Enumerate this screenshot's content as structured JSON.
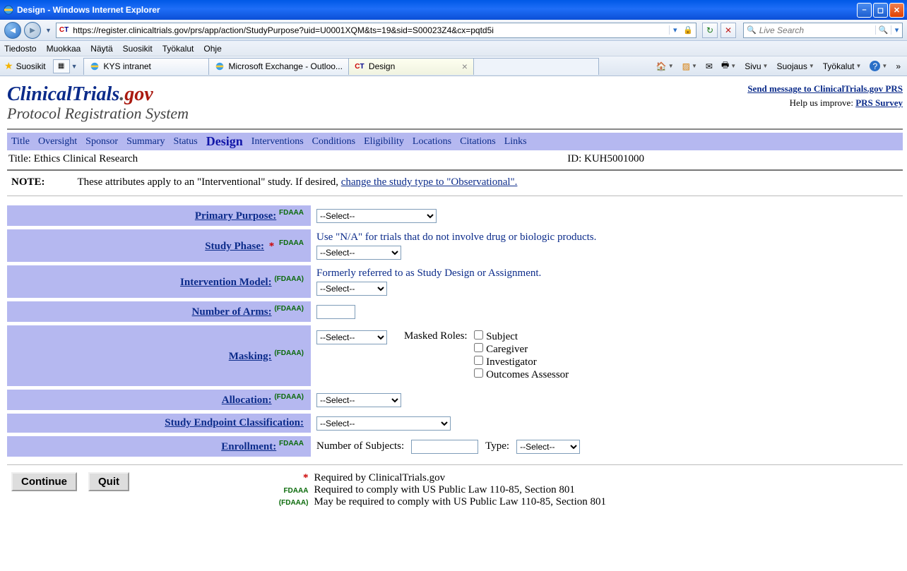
{
  "window": {
    "title": "Design - Windows Internet Explorer"
  },
  "address": {
    "url": "https://register.clinicaltrials.gov/prs/app/action/StudyPurpose?uid=U0001XQM&ts=19&sid=S00023Z4&cx=pqtd5i"
  },
  "search": {
    "placeholder": "Live Search"
  },
  "menus": {
    "items": [
      "Tiedosto",
      "Muokkaa",
      "Näytä",
      "Suosikit",
      "Työkalut",
      "Ohje"
    ]
  },
  "favorites_label": "Suosikit",
  "tabs": [
    {
      "label": "KYS intranet"
    },
    {
      "label": "Microsoft Exchange - Outloo..."
    },
    {
      "label": "Design",
      "active": true,
      "prefix": "CT"
    }
  ],
  "right_tools": {
    "page": "Sivu",
    "security": "Suojaus",
    "tools": "Työkalut"
  },
  "logo": {
    "part1": "ClinicalTrials",
    "part2": ".",
    "part3": "gov",
    "subtitle": "Protocol Registration System"
  },
  "header_links": {
    "send": "Send message to ClinicalTrials.gov PRS",
    "help_label": "Help us improve: ",
    "survey": "PRS Survey"
  },
  "nav": {
    "items": [
      "Title",
      "Oversight",
      "Sponsor",
      "Summary",
      "Status",
      "Design",
      "Interventions",
      "Conditions",
      "Eligibility",
      "Locations",
      "Citations",
      "Links"
    ],
    "active": "Design"
  },
  "idrow": {
    "title_label": "Title: ",
    "title_value": "Ethics Clinical Research",
    "id_label": "ID: ",
    "id_value": "KUH5001000"
  },
  "note": {
    "label": "NOTE:",
    "text_before": "These attributes apply to an \"Interventional\" study. If desired, ",
    "link": "change the study type to \"Observational\"."
  },
  "fields": {
    "primary_purpose": {
      "label": "Primary Purpose:",
      "badge": "FDAAA",
      "value": "--Select--"
    },
    "study_phase": {
      "label": "Study Phase:",
      "badge": "FDAAA",
      "required": true,
      "helper": "Use \"N/A\" for trials that do not involve drug or biologic products.",
      "value": "--Select--"
    },
    "intervention_model": {
      "label": "Intervention Model:",
      "badge": "(FDAAA)",
      "helper": "Formerly referred to as Study Design or Assignment.",
      "value": "--Select--"
    },
    "number_of_arms": {
      "label": "Number of Arms:",
      "badge": "(FDAAA)",
      "value": ""
    },
    "masking": {
      "label": "Masking:",
      "badge": "(FDAAA)",
      "value": "--Select--",
      "roles_label": "Masked Roles:",
      "roles": [
        "Subject",
        "Caregiver",
        "Investigator",
        "Outcomes Assessor"
      ]
    },
    "allocation": {
      "label": "Allocation:",
      "badge": "(FDAAA)",
      "value": "--Select--"
    },
    "endpoint": {
      "label": "Study Endpoint Classification:",
      "value": "--Select--"
    },
    "enrollment": {
      "label": "Enrollment:",
      "badge": "FDAAA",
      "subjects_label": "Number of Subjects:",
      "subjects_value": "",
      "type_label": "Type:",
      "type_value": "--Select--"
    }
  },
  "buttons": {
    "continue": "Continue",
    "quit": "Quit"
  },
  "legend": {
    "l1": "Required by ClinicalTrials.gov",
    "l2": "Required to comply with US Public Law 110-85, Section 801",
    "l3": "May be required to comply with US Public Law 110-85, Section 801",
    "k2": "FDAAA",
    "k3": "(FDAAA)"
  }
}
